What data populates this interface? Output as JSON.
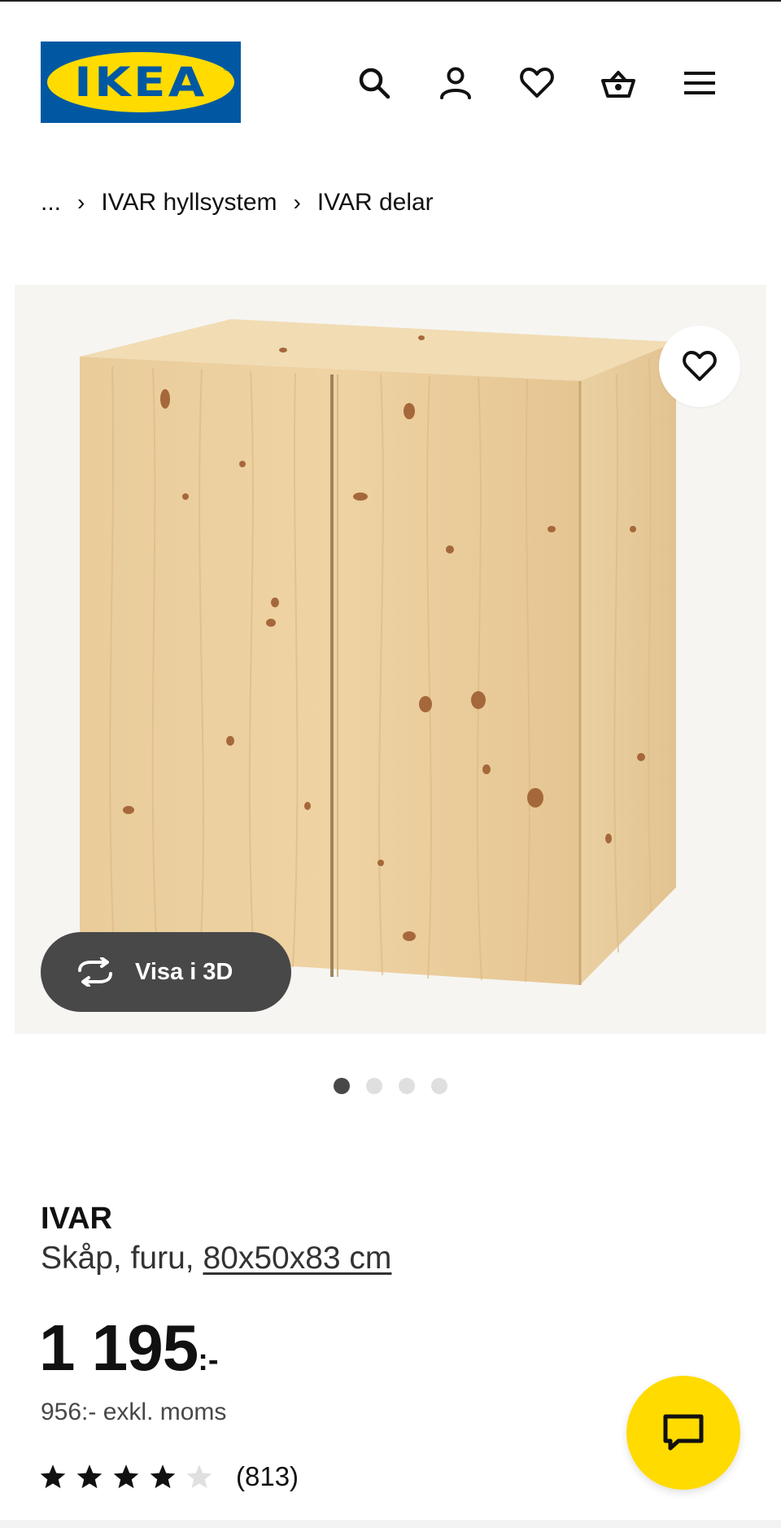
{
  "brand": {
    "logo_text": "IKEA",
    "registered": "®"
  },
  "header": {
    "icons": [
      "search-icon",
      "account-icon",
      "heart-icon",
      "basket-icon",
      "menu-icon"
    ]
  },
  "breadcrumb": {
    "items": [
      {
        "label": "..."
      },
      {
        "label": "IVAR hyllsystem"
      },
      {
        "label": "IVAR delar"
      }
    ],
    "separator": "›"
  },
  "gallery": {
    "view_3d_label": "Visa i 3D",
    "current_image": 1,
    "image_count": 4
  },
  "product": {
    "name": "IVAR",
    "description": "Skåp, furu,",
    "size": "80x50x83 cm",
    "price_main": "1 195",
    "price_suffix": ":-",
    "price_excl_vat": "956:- exkl. moms",
    "rating_value": 4,
    "rating_max": 5,
    "review_count": "(813)"
  },
  "colors": {
    "ikea_blue": "#0058a3",
    "ikea_yellow": "#ffdb00",
    "dark_button": "#484848"
  }
}
